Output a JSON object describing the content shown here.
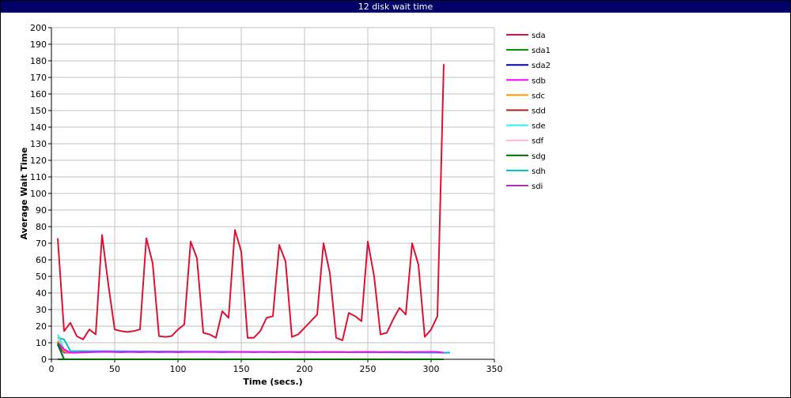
{
  "window": {
    "title": "12 disk wait time"
  },
  "colors": {
    "titlebar": "#000066",
    "grid": "#c0c0c0",
    "axis": "#000000"
  },
  "chart_data": {
    "type": "line",
    "xlabel": "Time (secs.)",
    "ylabel": "Average Wait Time",
    "xlim": [
      0,
      350
    ],
    "ylim": [
      0,
      200
    ],
    "xticks": [
      0,
      50,
      100,
      150,
      200,
      250,
      300,
      350
    ],
    "yticks": [
      0,
      10,
      20,
      30,
      40,
      50,
      60,
      70,
      80,
      90,
      100,
      110,
      120,
      130,
      140,
      150,
      160,
      170,
      180,
      190,
      200
    ],
    "grid": true,
    "legend_position": "right",
    "series": [
      {
        "name": "sda",
        "color": "#dd1133",
        "x": [
          5,
          10,
          15,
          20,
          25,
          30,
          35,
          40,
          45,
          50,
          55,
          60,
          65,
          70,
          75,
          80,
          85,
          90,
          95,
          100,
          105,
          110,
          115,
          120,
          125,
          130,
          135,
          140,
          145,
          150,
          155,
          160,
          165,
          170,
          175,
          180,
          185,
          190,
          195,
          200,
          205,
          210,
          215,
          220,
          225,
          230,
          235,
          240,
          245,
          250,
          255,
          260,
          265,
          270,
          275,
          280,
          285,
          290,
          295,
          300,
          305,
          310
        ],
        "y": [
          73,
          17,
          22,
          14,
          12,
          18,
          15,
          75,
          45,
          18,
          17,
          16.5,
          17,
          18,
          73,
          58,
          14,
          13.5,
          14,
          18,
          21,
          71,
          61,
          16,
          15,
          13,
          29,
          25,
          78,
          65,
          13,
          13,
          17,
          25,
          26,
          69,
          59,
          13.5,
          15,
          19,
          23,
          27,
          70,
          52,
          13,
          11.5,
          28,
          26,
          23,
          71,
          50,
          15,
          16,
          24,
          31,
          27,
          70,
          57,
          13.5,
          18,
          26,
          178
        ]
      },
      {
        "name": "sda1",
        "color": "#008800",
        "x": [
          5,
          10
        ],
        "y": [
          10,
          0
        ]
      },
      {
        "name": "sda2",
        "color": "#0000cc",
        "x": [
          5,
          10
        ],
        "y": [
          9,
          0
        ]
      },
      {
        "name": "sdb",
        "color": "#ff00ff",
        "x": [
          5,
          10,
          15,
          20,
          25,
          30,
          35,
          40,
          45,
          50,
          55,
          60,
          65,
          70,
          75,
          80,
          85,
          90,
          95,
          100,
          105,
          110,
          115,
          120,
          125,
          130,
          135,
          140,
          145,
          150,
          155,
          160,
          165,
          170,
          175,
          180,
          185,
          190,
          195,
          200,
          205,
          210,
          215,
          220,
          225,
          230,
          235,
          240,
          245,
          250,
          255,
          260,
          265,
          270,
          275,
          280,
          285,
          290,
          295,
          300,
          305,
          310
        ],
        "y": [
          10,
          6,
          4,
          4,
          4.2,
          4.3,
          4.4,
          4.5,
          4.5,
          4.4,
          4.3,
          4.4,
          4.4,
          4.3,
          4.4,
          4.4,
          4.3,
          4.4,
          4.4,
          4.3,
          4.4,
          4.4,
          4.4,
          4.5,
          4.4,
          4.4,
          4.3,
          4.4,
          4.4,
          4.4,
          4.4,
          4.3,
          4.4,
          4.4,
          4.3,
          4.4,
          4.4,
          4.4,
          4.3,
          4.4,
          4.4,
          4.3,
          4.5,
          4.4,
          4.4,
          4.4,
          4.3,
          4.4,
          4.4,
          4.5,
          4.4,
          4.3,
          4.4,
          4.4,
          4.4,
          4.3,
          4.4,
          4.4,
          4.4,
          4.5,
          4.5,
          4
        ]
      },
      {
        "name": "sdc",
        "color": "#ff9900",
        "x": [
          5,
          10,
          15
        ],
        "y": [
          11,
          5,
          4
        ]
      },
      {
        "name": "sdd",
        "color": "#aa2222",
        "x": [
          5,
          10,
          15
        ],
        "y": [
          9,
          5,
          4
        ]
      },
      {
        "name": "sde",
        "color": "#33eeee",
        "x": [
          5,
          10,
          15
        ],
        "y": [
          15,
          6,
          4
        ]
      },
      {
        "name": "sdf",
        "color": "#ffbbcc",
        "x": [
          5,
          10,
          15
        ],
        "y": [
          12,
          5,
          4
        ]
      },
      {
        "name": "sdg",
        "color": "#006600",
        "x": [
          5,
          10,
          310
        ],
        "y": [
          0,
          0,
          0
        ]
      },
      {
        "name": "sdh",
        "color": "#00bbcc",
        "x": [
          5,
          10,
          15,
          310,
          315
        ],
        "y": [
          13,
          12,
          5,
          4,
          4
        ]
      },
      {
        "name": "sdi",
        "color": "#aa33aa",
        "x": [
          5,
          10,
          15
        ],
        "y": [
          9,
          4,
          4
        ]
      }
    ]
  }
}
